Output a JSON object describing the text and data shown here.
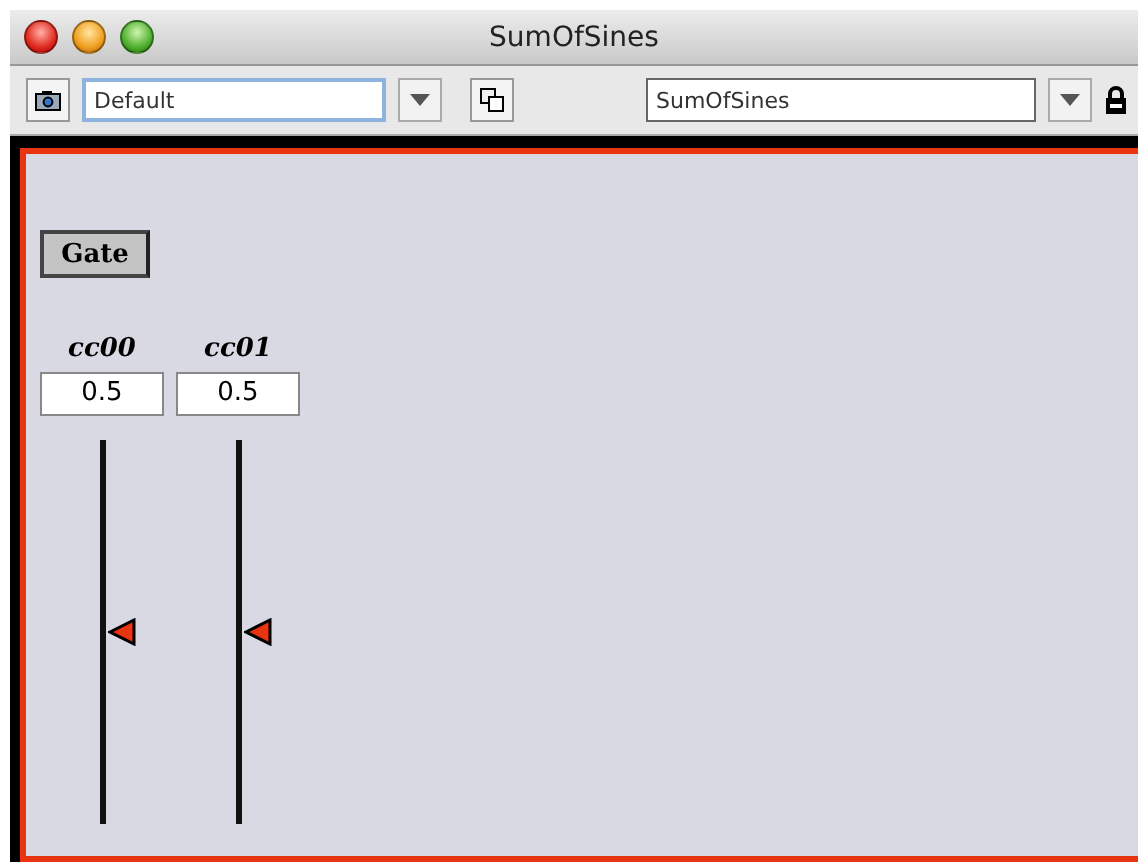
{
  "window": {
    "title": "SumOfSines"
  },
  "toolbar": {
    "preset": {
      "value": "Default"
    },
    "patch": {
      "value": "SumOfSines"
    }
  },
  "gate_button": {
    "label": "Gate"
  },
  "controls": [
    {
      "name": "cc00",
      "value": "0.5",
      "level": 0.5
    },
    {
      "name": "cc01",
      "value": "0.5",
      "level": 0.5
    }
  ]
}
